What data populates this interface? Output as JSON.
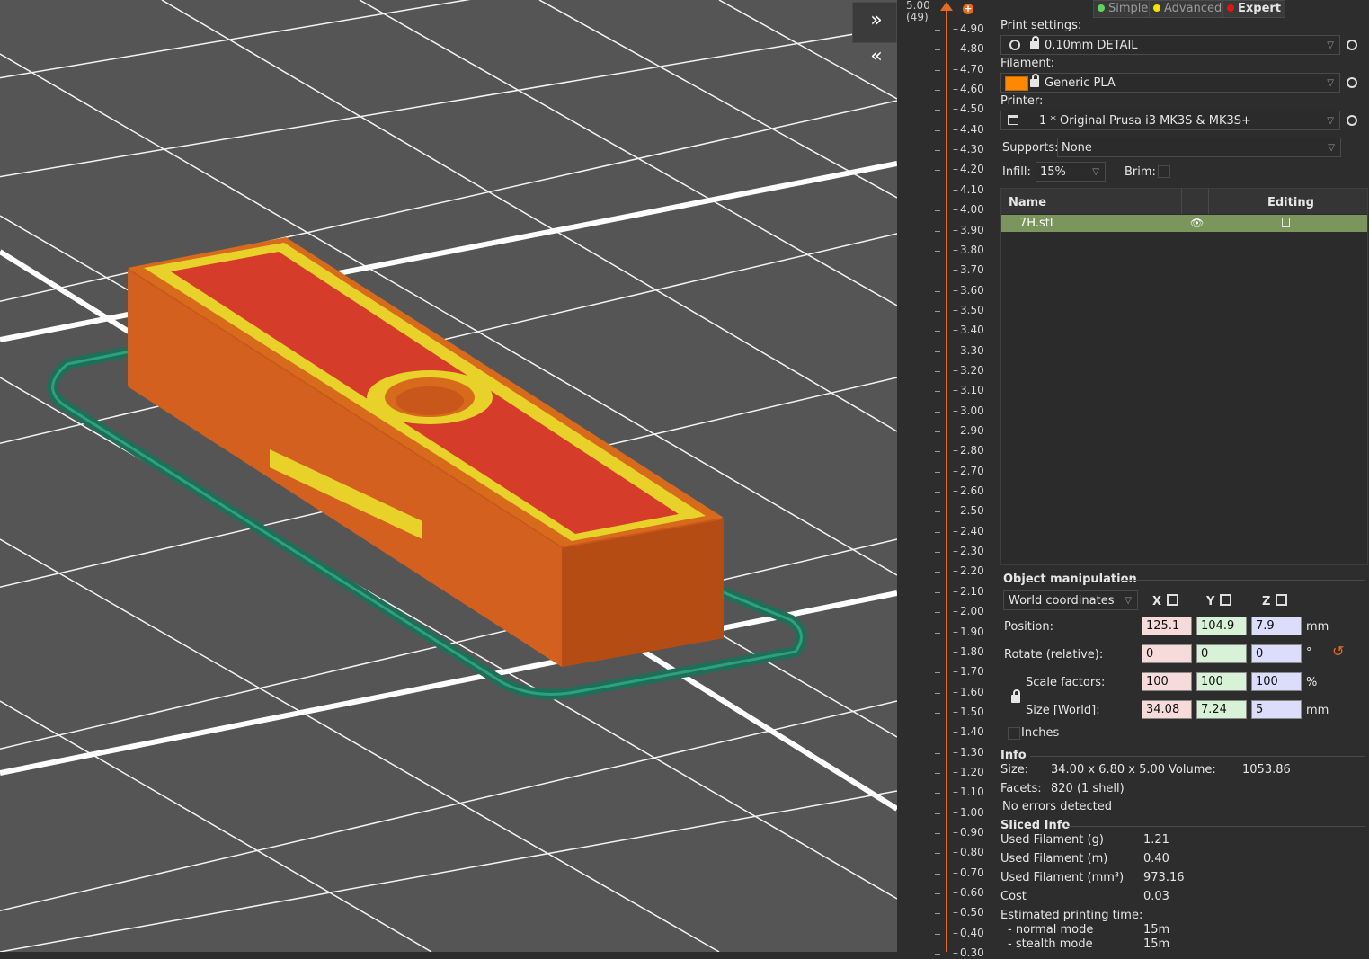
{
  "modes": {
    "simple": "Simple",
    "advanced": "Advanced",
    "expert": "Expert"
  },
  "colors": {
    "simple_dot": "#5fd35f",
    "advanced_dot": "#f2e600",
    "expert_dot": "#e01616",
    "filament": "#ff8800",
    "highlight_row": "#7b955d",
    "slider_accent": "#e66a1d"
  },
  "slider": {
    "top_value": "5.00",
    "top_layer": "(49)",
    "ticks": [
      "4.90",
      "4.80",
      "4.70",
      "4.60",
      "4.50",
      "4.40",
      "4.30",
      "4.20",
      "4.10",
      "4.00",
      "3.90",
      "3.80",
      "3.70",
      "3.60",
      "3.50",
      "3.40",
      "3.30",
      "3.20",
      "3.10",
      "3.00",
      "2.90",
      "2.80",
      "2.70",
      "2.60",
      "2.50",
      "2.40",
      "2.30",
      "2.20",
      "2.10",
      "2.00",
      "1.90",
      "1.80",
      "1.70",
      "1.60",
      "1.50",
      "1.40",
      "1.30",
      "1.20",
      "1.10",
      "1.00",
      "0.90",
      "0.80",
      "0.70",
      "0.60",
      "0.50",
      "0.40",
      "0.30"
    ]
  },
  "print_settings": {
    "label": "Print settings:",
    "value": "0.10mm DETAIL"
  },
  "filament": {
    "label": "Filament:",
    "value": "Generic PLA"
  },
  "printer": {
    "label": "Printer:",
    "value": "1 * Original Prusa i3 MK3S & MK3S+"
  },
  "supports": {
    "label": "Supports:",
    "value": "None"
  },
  "infill": {
    "label": "Infill:",
    "value": "15%"
  },
  "brim": {
    "label": "Brim:"
  },
  "object_list": {
    "col_name": "Name",
    "col_editing": "Editing",
    "rows": [
      {
        "name": "7H.stl"
      }
    ]
  },
  "manipulation": {
    "title": "Object manipulation",
    "coords": "World coordinates",
    "x": "X",
    "y": "Y",
    "z": "Z",
    "position": {
      "label": "Position:",
      "x": "125.1",
      "y": "104.9",
      "z": "7.9",
      "unit": "mm"
    },
    "rotate": {
      "label": "Rotate (relative):",
      "x": "0",
      "y": "0",
      "z": "0",
      "unit": "°"
    },
    "scale": {
      "label": "Scale factors:",
      "x": "100",
      "y": "100",
      "z": "100",
      "unit": "%"
    },
    "size": {
      "label": "Size [World]:",
      "x": "34.08",
      "y": "7.24",
      "z": "5",
      "unit": "mm"
    },
    "inches": "Inches"
  },
  "info": {
    "title": "Info",
    "size_label": "Size:",
    "size_value": "34.00 x 6.80 x 5.00",
    "volume_label": "Volume:",
    "volume_value": "1053.86",
    "facets_label": "Facets:",
    "facets_value": "820 (1 shell)",
    "errors": "No errors detected"
  },
  "sliced": {
    "title": "Sliced Info",
    "rows": [
      {
        "label": "Used Filament (g)",
        "value": "1.21"
      },
      {
        "label": "Used Filament (m)",
        "value": "0.40"
      },
      {
        "label": "Used Filament (mm³)",
        "value": "973.16"
      },
      {
        "label": "Cost",
        "value": "0.03"
      }
    ],
    "time_label": "Estimated printing time:",
    "normal_label": "- normal mode",
    "normal_value": "15m",
    "stealth_label": "- stealth mode",
    "stealth_value": "15m"
  }
}
